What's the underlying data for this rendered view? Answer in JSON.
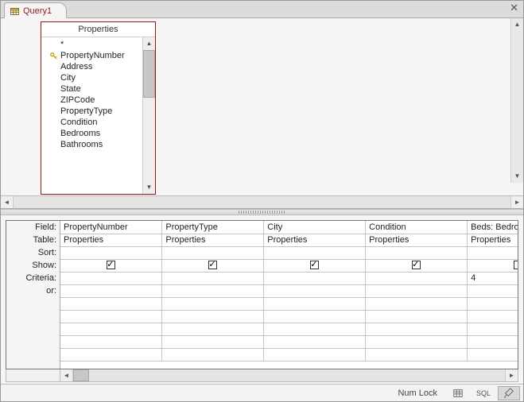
{
  "tab": {
    "label": "Query1"
  },
  "table_box": {
    "title": "Properties",
    "star": "*",
    "pk_field": "PropertyNumber",
    "fields": [
      "Address",
      "City",
      "State",
      "ZIPCode",
      "PropertyType",
      "Condition",
      "Bedrooms",
      "Bathrooms"
    ]
  },
  "grid": {
    "row_labels": {
      "field": "Field:",
      "table": "Table:",
      "sort": "Sort:",
      "show": "Show:",
      "criteria": "Criteria:",
      "or": "or:"
    },
    "columns": [
      {
        "field": "PropertyNumber",
        "table": "Properties",
        "sort": "",
        "show": true,
        "criteria": "",
        "or": ""
      },
      {
        "field": "PropertyType",
        "table": "Properties",
        "sort": "",
        "show": true,
        "criteria": "",
        "or": ""
      },
      {
        "field": "City",
        "table": "Properties",
        "sort": "",
        "show": true,
        "criteria": "",
        "or": ""
      },
      {
        "field": "Condition",
        "table": "Properties",
        "sort": "",
        "show": true,
        "criteria": "",
        "or": ""
      },
      {
        "field": "Beds: Bedrooms",
        "table": "Properties",
        "sort": "",
        "show": false,
        "criteria": "4",
        "or": ""
      }
    ]
  },
  "status": {
    "numlock": "Num Lock",
    "sql_label": "SQL"
  }
}
